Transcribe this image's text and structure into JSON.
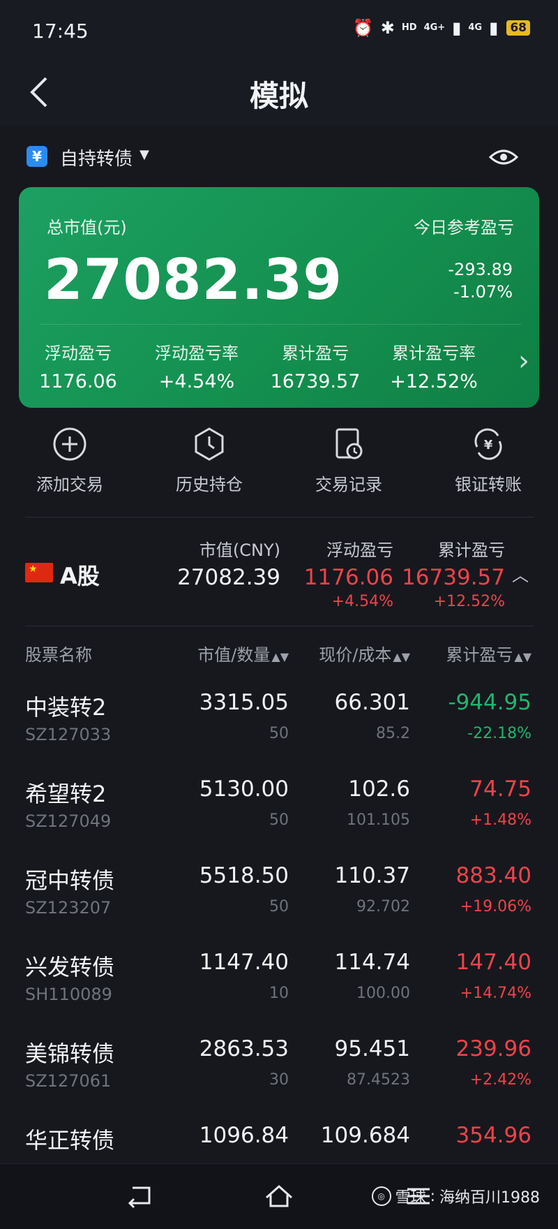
{
  "status_bar": {
    "time": "17:45",
    "network_1": "4G+",
    "network_2": "4G",
    "hd_label": "HD",
    "battery": "68"
  },
  "header": {
    "title": "模拟"
  },
  "account": {
    "name": "自持转债",
    "icon_text": "¥"
  },
  "summary": {
    "total_label": "总市值(元)",
    "total_value": "27082.39",
    "today_label": "今日参考盈亏",
    "today_amount": "-293.89",
    "today_pct": "-1.07%",
    "stats": [
      {
        "label": "浮动盈亏",
        "value": "1176.06"
      },
      {
        "label": "浮动盈亏率",
        "value": "+4.54%"
      },
      {
        "label": "累计盈亏",
        "value": "16739.57"
      },
      {
        "label": "累计盈亏率",
        "value": "+12.52%"
      }
    ]
  },
  "actions": [
    {
      "label": "添加交易",
      "icon": "plus-circle-icon"
    },
    {
      "label": "历史持仓",
      "icon": "clock-hexagon-icon"
    },
    {
      "label": "交易记录",
      "icon": "record-clock-icon"
    },
    {
      "label": "银证转账",
      "icon": "yuan-transfer-icon"
    }
  ],
  "market": {
    "name": "A股",
    "mv_label": "市值(CNY)",
    "mv_value": "27082.39",
    "float_label": "浮动盈亏",
    "float_value": "1176.06",
    "float_pct": "+4.54%",
    "cum_label": "累计盈亏",
    "cum_value": "16739.57",
    "cum_pct": "+12.52%"
  },
  "table": {
    "col_name": "股票名称",
    "col_mv": "市值/数量",
    "col_price": "现价/成本",
    "col_pl": "累计盈亏",
    "rows": [
      {
        "name": "中装转2",
        "code": "SZ127033",
        "mv": "3315.05",
        "qty": "50",
        "price": "66.301",
        "cost": "85.2",
        "pl": "-944.95",
        "plpct": "-22.18%",
        "dir": "down"
      },
      {
        "name": "希望转2",
        "code": "SZ127049",
        "mv": "5130.00",
        "qty": "50",
        "price": "102.6",
        "cost": "101.105",
        "pl": "74.75",
        "plpct": "+1.48%",
        "dir": "up"
      },
      {
        "name": "冠中转债",
        "code": "SZ123207",
        "mv": "5518.50",
        "qty": "50",
        "price": "110.37",
        "cost": "92.702",
        "pl": "883.40",
        "plpct": "+19.06%",
        "dir": "up"
      },
      {
        "name": "兴发转债",
        "code": "SH110089",
        "mv": "1147.40",
        "qty": "10",
        "price": "114.74",
        "cost": "100.00",
        "pl": "147.40",
        "plpct": "+14.74%",
        "dir": "up"
      },
      {
        "name": "美锦转债",
        "code": "SZ127061",
        "mv": "2863.53",
        "qty": "30",
        "price": "95.451",
        "cost": "87.4523",
        "pl": "239.96",
        "plpct": "+2.42%",
        "dir": "up"
      },
      {
        "name": "华正转债",
        "code": "",
        "mv": "1096.84",
        "qty": "",
        "price": "109.684",
        "cost": "",
        "pl": "354.96",
        "plpct": "",
        "dir": "up"
      }
    ]
  },
  "watermark": {
    "brand": "雪球",
    "author": "海纳百川1988"
  },
  "colors": {
    "up": "#f0424b",
    "down": "#1fb56e",
    "card": "#14904f",
    "background": "#16181d"
  }
}
